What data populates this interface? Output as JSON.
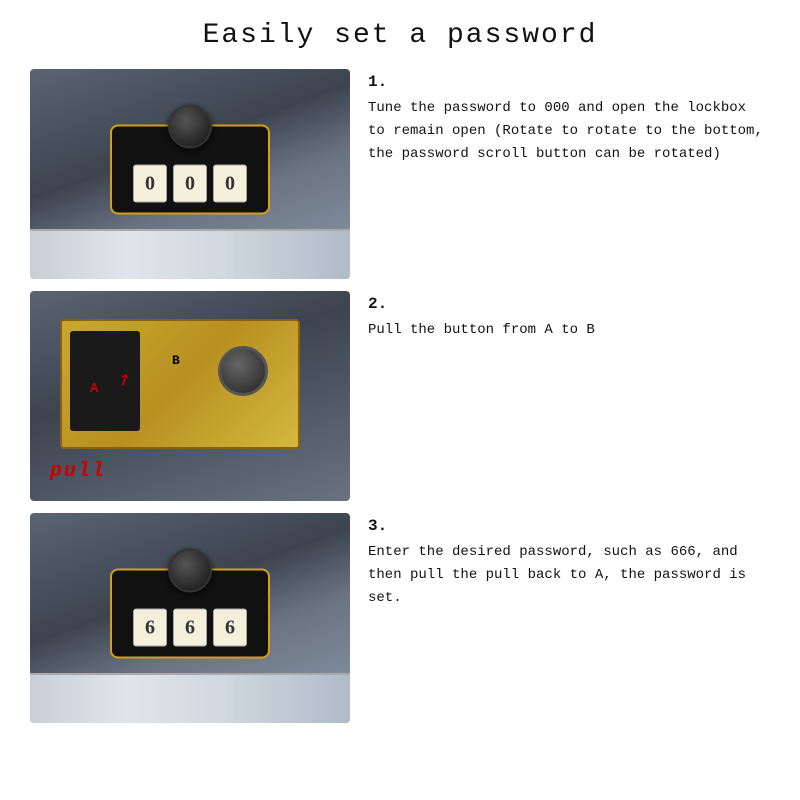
{
  "page": {
    "title": "Easily set a password",
    "background_color": "#ffffff"
  },
  "steps": [
    {
      "number": "1.",
      "description": "Tune the password to 000 and open the lockbox to remain open (Rotate to rotate to the bottom, the password scroll button can be rotated)",
      "image_alt": "Lockbox closed showing combination dial and number display showing 000"
    },
    {
      "number": "2.",
      "description": "Pull the button from A to B",
      "image_alt": "Internal mechanism of lockbox showing button A and B positions with pull text",
      "labels": {
        "a": "A",
        "b": "B",
        "pull": "pull"
      }
    },
    {
      "number": "3.",
      "description": "Enter the desired password, such as 666, and then pull the pull back to A, the password is set.",
      "image_alt": "Lockbox showing combination dial for entering new password"
    }
  ]
}
